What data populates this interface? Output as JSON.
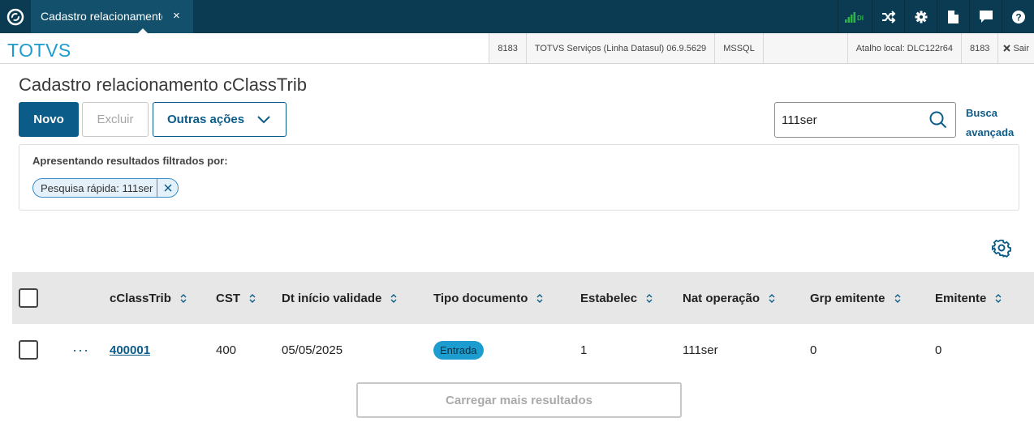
{
  "topbar": {
    "tab_label": "Cadastro relacionamento cClassTrib",
    "tab_close": "×",
    "signal_text": "DI"
  },
  "infobar": {
    "brand": "TOTVS",
    "cells": [
      "8183",
      "TOTVS Serviços (Linha Datasul) 06.9.5629",
      "MSSQL"
    ],
    "atalho": "Atalho local: DLC122r64",
    "port": "8183",
    "sair_label": "Sair"
  },
  "page": {
    "title": "Cadastro relacionamento cClassTrib",
    "buttons": {
      "novo": "Novo",
      "excluir": "Excluir",
      "outras": "Outras ações"
    },
    "search": {
      "value": "111ser",
      "placeholder": ""
    },
    "busca_avancada": "Busca avançada"
  },
  "filter": {
    "title": "Apresentando resultados filtrados por:",
    "chip": "Pesquisa rápida: 111ser"
  },
  "table": {
    "columns": [
      "cClassTrib",
      "CST",
      "Dt início validade",
      "Tipo documento",
      "Estabelec",
      "Nat operação",
      "Grp emitente",
      "Emitente"
    ],
    "rows": [
      {
        "cclasstrib": "400001",
        "cst": "400",
        "dt_inicio": "05/05/2025",
        "tipo_documento": "Entrada",
        "estabelec": "1",
        "nat_operacao": "111ser",
        "grp_emitente": "0",
        "emitente": "0"
      }
    ],
    "row_actions": "···"
  },
  "load_more": "Carregar mais resultados",
  "colors": {
    "header_bg": "#0b3b52",
    "tab_bg": "#12506b",
    "primary": "#0c5c8a",
    "brand": "#1c9ccf",
    "signal": "#2fb34a"
  }
}
